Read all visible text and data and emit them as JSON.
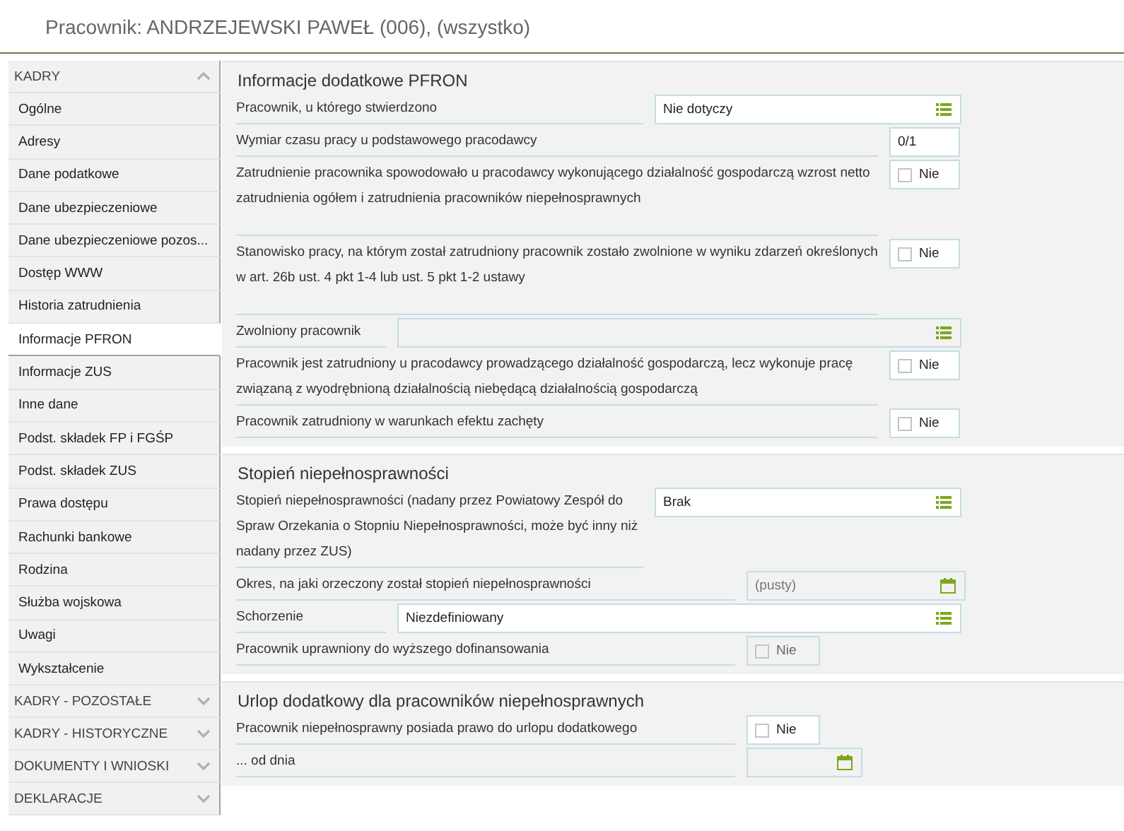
{
  "header": {
    "title": "Pracownik: ANDRZEJEWSKI PAWEŁ (006), (wszystko)"
  },
  "sidebar": {
    "groups": [
      {
        "label": "KADRY",
        "expanded": true,
        "items": [
          {
            "label": "Ogólne",
            "selected": false
          },
          {
            "label": "Adresy",
            "selected": false
          },
          {
            "label": "Dane podatkowe",
            "selected": false
          },
          {
            "label": "Dane ubezpieczeniowe",
            "selected": false
          },
          {
            "label": "Dane ubezpieczeniowe pozos...",
            "selected": false
          },
          {
            "label": "Dostęp WWW",
            "selected": false
          },
          {
            "label": "Historia zatrudnienia",
            "selected": false
          },
          {
            "label": "Informacje PFRON",
            "selected": true
          },
          {
            "label": "Informacje ZUS",
            "selected": false
          },
          {
            "label": "Inne dane",
            "selected": false
          },
          {
            "label": "Podst. składek FP i FGŚP",
            "selected": false
          },
          {
            "label": "Podst. składek ZUS",
            "selected": false
          },
          {
            "label": "Prawa dostępu",
            "selected": false
          },
          {
            "label": "Rachunki bankowe",
            "selected": false
          },
          {
            "label": "Rodzina",
            "selected": false
          },
          {
            "label": "Służba wojskowa",
            "selected": false
          },
          {
            "label": "Uwagi",
            "selected": false
          },
          {
            "label": "Wykształcenie",
            "selected": false
          }
        ]
      },
      {
        "label": "KADRY - POZOSTAŁE",
        "expanded": false
      },
      {
        "label": "KADRY - HISTORYCZNE",
        "expanded": false
      },
      {
        "label": "DOKUMENTY I WNIOSKI",
        "expanded": false
      },
      {
        "label": "DEKLARACJE",
        "expanded": false
      }
    ]
  },
  "sections": [
    {
      "title": "Informacje dodatkowe PFRON",
      "rows": [
        {
          "kind": "select",
          "label": "Pracownik, u którego stwierdzono",
          "value": "Nie dotyczy",
          "disabled": false
        },
        {
          "kind": "text",
          "label": "Wymiar czasu pracy u podstawowego pracodawcy",
          "value": "0/1",
          "disabled": false
        },
        {
          "kind": "checkbox",
          "label": "Zatrudnienie pracownika spowodowało u pracodawcy wykonującego działalność gospodarczą wzrost netto zatrudnienia ogółem i zatrudnienia pracowników niepełnosprawnych",
          "value": "Nie",
          "checked": false,
          "disabled": false
        },
        {
          "kind": "checkbox",
          "label": "Stanowisko pracy, na którym został zatrudniony pracownik zostało zwolnione w wyniku zdarzeń określonych w art. 26b ust. 4 pkt 1-4 lub ust. 5 pkt 1-2 ustawy",
          "value": "Nie",
          "checked": false,
          "disabled": false
        },
        {
          "kind": "select",
          "label": "Zwolniony pracownik",
          "disabled": true
        },
        {
          "kind": "checkbox",
          "label": "Pracownik jest zatrudniony u pracodawcy prowadzącego działalność gospodarczą, lecz wykonuje pracę związaną z wyodrębnioną działalnością niebędącą działalnością gospodarczą",
          "value": "Nie",
          "checked": false,
          "disabled": false
        },
        {
          "kind": "checkbox",
          "label": "Pracownik zatrudniony w warunkach efektu zachęty",
          "value": "Nie",
          "checked": false,
          "disabled": false
        }
      ]
    },
    {
      "title": "Stopień niepełnosprawności",
      "rows": [
        {
          "kind": "select",
          "label": "Stopień niepełnosprawności (nadany przez Powiatowy Zespół do Spraw Orzekania o Stopniu Niepełnosprawności, może być inny niż nadany przez ZUS)",
          "value": "Brak",
          "disabled": false
        },
        {
          "kind": "date",
          "label": "Okres, na jaki orzeczony został stopień niepełnosprawności",
          "placeholder": "(pusty)",
          "disabled": true
        },
        {
          "kind": "select",
          "label": "Schorzenie",
          "value": "Niezdefiniowany",
          "disabled": false
        },
        {
          "kind": "checkbox",
          "label": "Pracownik uprawniony do wyższego dofinansowania",
          "value": "Nie",
          "checked": false,
          "disabled": true
        }
      ]
    },
    {
      "title": "Urlop dodatkowy dla pracowników niepełnosprawnych",
      "rows": [
        {
          "kind": "checkbox",
          "label": "Pracownik niepełnosprawny posiada prawo do urlopu dodatkowego",
          "value": "Nie",
          "checked": false,
          "disabled": false
        },
        {
          "kind": "date",
          "label": "... od dnia",
          "disabled": true
        }
      ]
    }
  ]
}
